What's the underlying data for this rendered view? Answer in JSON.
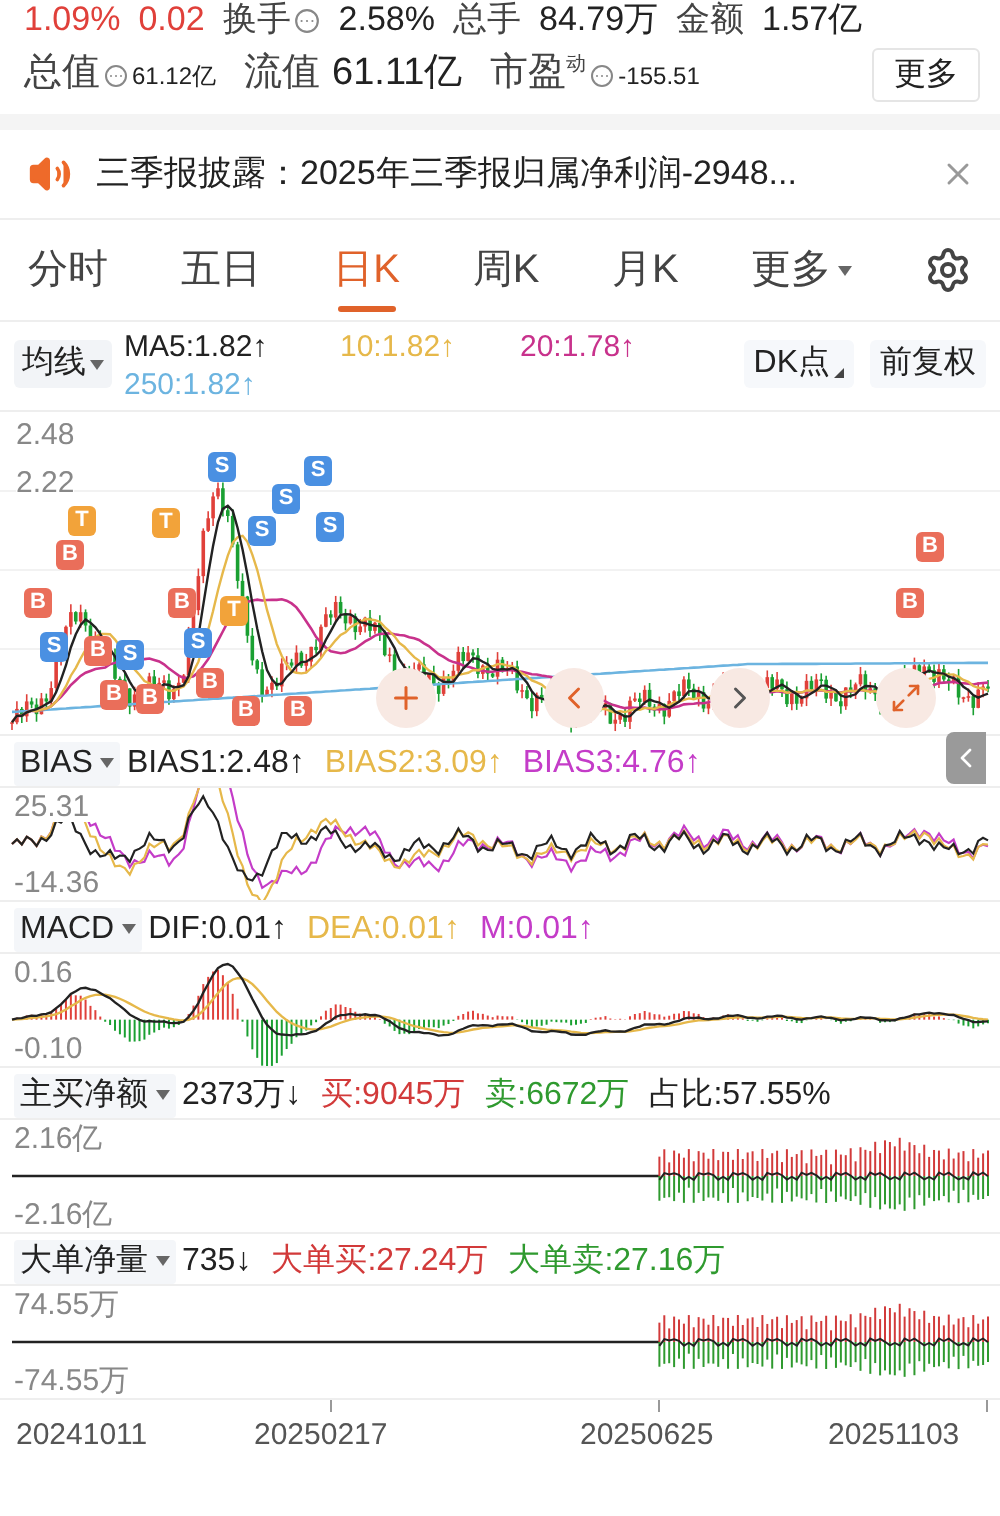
{
  "quote_row": [
    {
      "text": "1.09%",
      "kind": "change"
    },
    {
      "text": "0.02",
      "kind": "change"
    },
    {
      "text": "换手",
      "kind": "label",
      "info": true
    },
    {
      "text": "2.58%",
      "kind": "value"
    },
    {
      "text": "总手",
      "kind": "label",
      "info": false
    },
    {
      "text": "84.79万",
      "kind": "value"
    },
    {
      "text": "金额",
      "kind": "label",
      "info": false
    },
    {
      "text": "1.57亿",
      "kind": "value"
    }
  ],
  "stats": [
    {
      "label": "总值",
      "value": "61.12亿",
      "info": true
    },
    {
      "label": "流值",
      "value": "61.11亿",
      "info": false
    },
    {
      "label": "市盈",
      "sup": "动",
      "value": "-155.51",
      "info": true
    }
  ],
  "more_button": "更多",
  "notice": {
    "text": "三季报披露：2025年三季报归属净利润-2948..."
  },
  "tabs": [
    {
      "label": "分时",
      "selected": false,
      "kind": "plain"
    },
    {
      "label": "五日",
      "selected": false,
      "kind": "plain"
    },
    {
      "label": "日K",
      "selected": true,
      "kind": "plain"
    },
    {
      "label": "周K",
      "selected": false,
      "kind": "plain"
    },
    {
      "label": "月K",
      "selected": false,
      "kind": "plain"
    },
    {
      "label": "更多",
      "selected": false,
      "kind": "dropdown"
    }
  ],
  "ma_legend": {
    "selector": "均线",
    "items": [
      {
        "text": "MA5:1.82↑",
        "color": "#222222"
      },
      {
        "text": "10:1.82↑",
        "color": "#e6b84a"
      },
      {
        "text": "20:1.78↑",
        "color": "#c8328c"
      },
      {
        "text": "250:1.82↑",
        "color": "#6cb4e0"
      }
    ],
    "dk_button": "DK点",
    "adjust_button": "前复权"
  },
  "price_chart": {
    "axis_labels": [
      "2.48",
      "2.22"
    ],
    "markers": [
      {
        "label": "B"
      },
      {
        "label": "S"
      },
      {
        "label": "B"
      },
      {
        "label": "T"
      },
      {
        "label": "B"
      },
      {
        "label": "B"
      },
      {
        "label": "S"
      },
      {
        "label": "B"
      },
      {
        "label": "T"
      },
      {
        "label": "B"
      },
      {
        "label": "S"
      },
      {
        "label": "B"
      },
      {
        "label": "S"
      },
      {
        "label": "T"
      },
      {
        "label": "B"
      },
      {
        "label": "S"
      },
      {
        "label": "S"
      },
      {
        "label": "B"
      },
      {
        "label": "S"
      },
      {
        "label": "S"
      },
      {
        "label": "B"
      },
      {
        "label": "B"
      }
    ]
  },
  "indicators": [
    {
      "kind": "bias",
      "selector": "BIAS",
      "values": [
        {
          "text": "BIAS1:2.48↑",
          "color": "#222222"
        },
        {
          "text": "BIAS2:3.09↑",
          "color": "#e6b84a"
        },
        {
          "text": "BIAS3:4.76↑",
          "color": "#c43cc8"
        }
      ],
      "axis_labels": [
        "25.31",
        "-14.36"
      ]
    },
    {
      "kind": "macd",
      "selector": "MACD",
      "values": [
        {
          "text": "DIF:0.01↑",
          "color": "#222222"
        },
        {
          "text": "DEA:0.01↑",
          "color": "#e6b84a"
        },
        {
          "text": "M:0.01↑",
          "color": "#c43cc8"
        }
      ],
      "axis_labels": [
        "0.16",
        "-0.10"
      ]
    },
    {
      "kind": "flow",
      "selector": "主买净额",
      "values": [
        {
          "text": "2373万↓",
          "color": "#222222"
        },
        {
          "text": "买:9045万",
          "color": "#d23a3a"
        },
        {
          "text": "卖:6672万",
          "color": "#2f9a2f"
        },
        {
          "text": "占比:57.55%",
          "color": "#222222"
        }
      ],
      "axis_labels": [
        "2.16亿",
        "-2.16亿"
      ]
    },
    {
      "kind": "flow",
      "selector": "大单净量",
      "values": [
        {
          "text": "735↓",
          "color": "#222222"
        },
        {
          "text": "大单买:27.24万",
          "color": "#d23a3a"
        },
        {
          "text": "大单卖:27.16万",
          "color": "#2f9a2f"
        }
      ],
      "axis_labels": [
        "74.55万",
        "-74.55万"
      ]
    }
  ],
  "dates": [
    "20241011",
    "20250217",
    "20250625",
    "20251103"
  ]
}
